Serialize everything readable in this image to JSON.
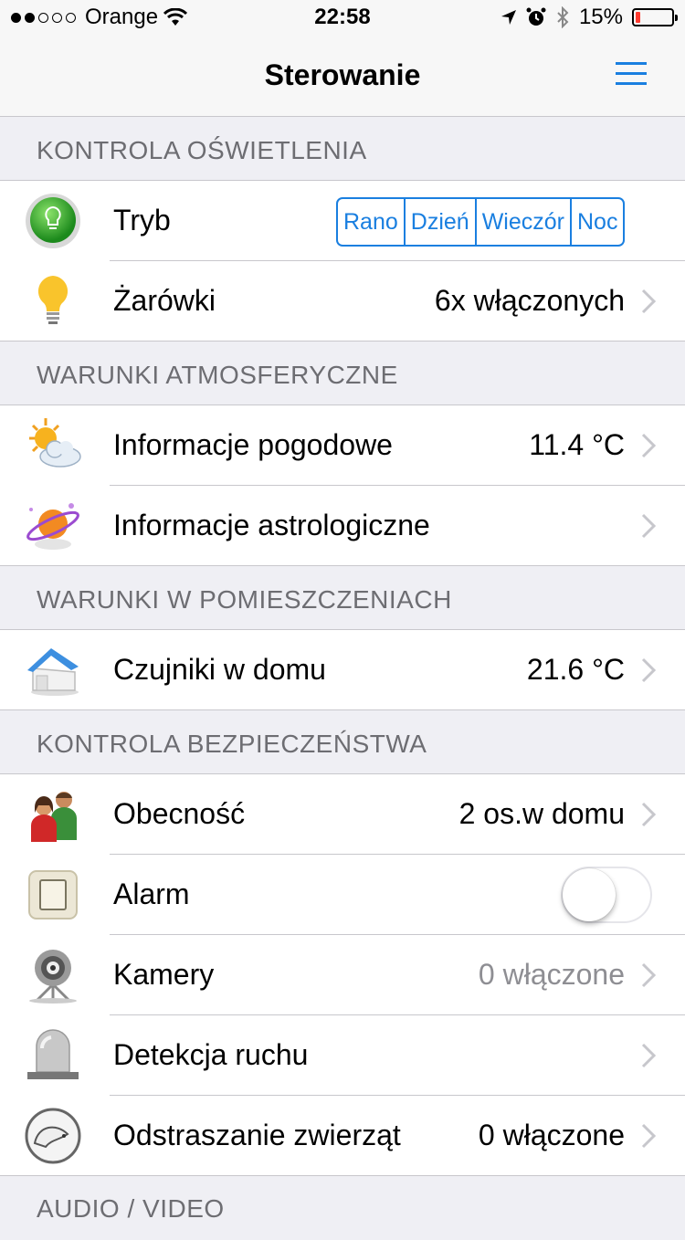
{
  "status_bar": {
    "carrier": "Orange",
    "time": "22:58",
    "battery": "15%"
  },
  "header": {
    "title": "Sterowanie"
  },
  "sections": {
    "lighting": {
      "title": "KONTROLA OŚWIETLENIA"
    },
    "weather": {
      "title": "WARUNKI ATMOSFERYCZNE"
    },
    "rooms": {
      "title": "WARUNKI W POMIESZCZENIACH"
    },
    "security": {
      "title": "KONTROLA BEZPIECZEŃSTWA"
    },
    "av": {
      "title": "AUDIO / VIDEO"
    }
  },
  "rows": {
    "mode": {
      "label": "Tryb",
      "options": [
        "Rano",
        "Dzień",
        "Wieczór",
        "Noc"
      ]
    },
    "bulbs": {
      "label": "Żarówki",
      "value": "6x włączonych"
    },
    "weather_info": {
      "label": "Informacje pogodowe",
      "value": "11.4 °C"
    },
    "astro_info": {
      "label": "Informacje astrologiczne"
    },
    "home_sensors": {
      "label": "Czujniki w domu",
      "value": "21.6 °C"
    },
    "presence": {
      "label": "Obecność",
      "value": "2 os.w domu"
    },
    "alarm": {
      "label": "Alarm",
      "enabled": false
    },
    "cameras": {
      "label": "Kamery",
      "value": "0 włączone"
    },
    "motion": {
      "label": "Detekcja ruchu"
    },
    "animals": {
      "label": "Odstraszanie zwierząt",
      "value": "0 włączone"
    }
  },
  "colors": {
    "accent": "#1a7fe0",
    "battery_low": "#ff3b30"
  }
}
